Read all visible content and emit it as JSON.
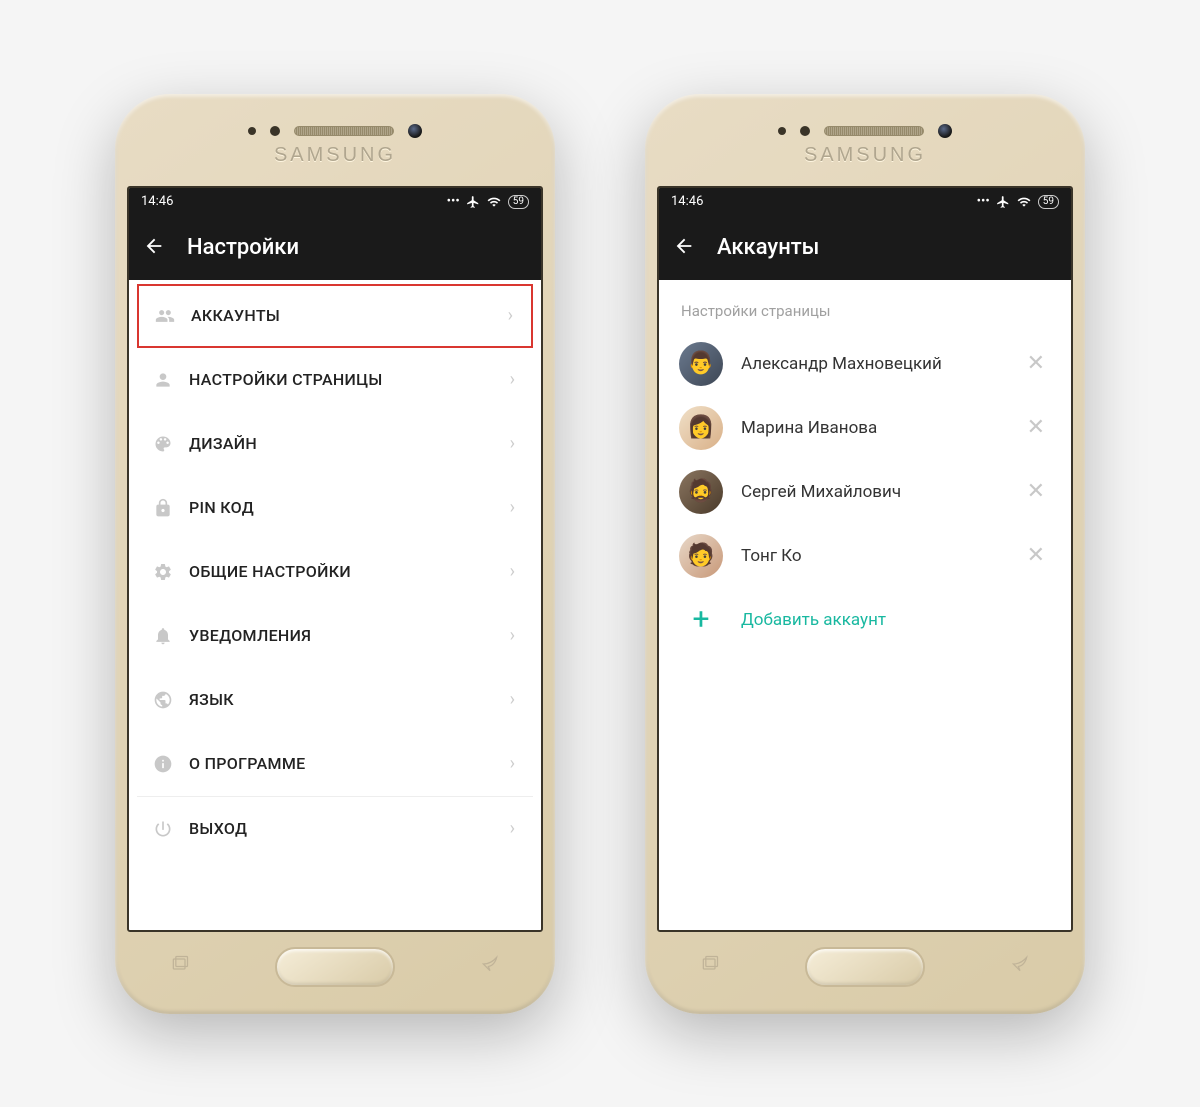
{
  "device": {
    "brand": "SAMSUNG"
  },
  "status": {
    "time": "14:46",
    "battery": "59"
  },
  "left": {
    "header_title": "Настройки",
    "items": [
      {
        "label": "АККАУНТЫ",
        "icon": "users-icon",
        "highlighted": true
      },
      {
        "label": "НАСТРОЙКИ СТРАНИЦЫ",
        "icon": "person-icon",
        "highlighted": false
      },
      {
        "label": "ДИЗАЙН",
        "icon": "palette-icon",
        "highlighted": false
      },
      {
        "label": "PIN КОД",
        "icon": "lock-icon",
        "highlighted": false
      },
      {
        "label": "ОБЩИЕ НАСТРОЙКИ",
        "icon": "gear-icon",
        "highlighted": false
      },
      {
        "label": "УВЕДОМЛЕНИЯ",
        "icon": "bell-icon",
        "highlighted": false
      },
      {
        "label": "ЯЗЫК",
        "icon": "globe-icon",
        "highlighted": false
      },
      {
        "label": "О ПРОГРАММЕ",
        "icon": "info-icon",
        "highlighted": false
      },
      {
        "label": "ВЫХОД",
        "icon": "power-icon",
        "highlighted": false
      }
    ]
  },
  "right": {
    "header_title": "Аккаунты",
    "section_label": "Настройки страницы",
    "accounts": [
      {
        "name": "Александр Махновецкий"
      },
      {
        "name": "Марина Иванова"
      },
      {
        "name": "Сергей Михайлович"
      },
      {
        "name": "Тонг Ко"
      }
    ],
    "add_label": "Добавить аккаунт"
  },
  "colors": {
    "accent": "#18b8a0",
    "highlight_border": "#d93630"
  }
}
